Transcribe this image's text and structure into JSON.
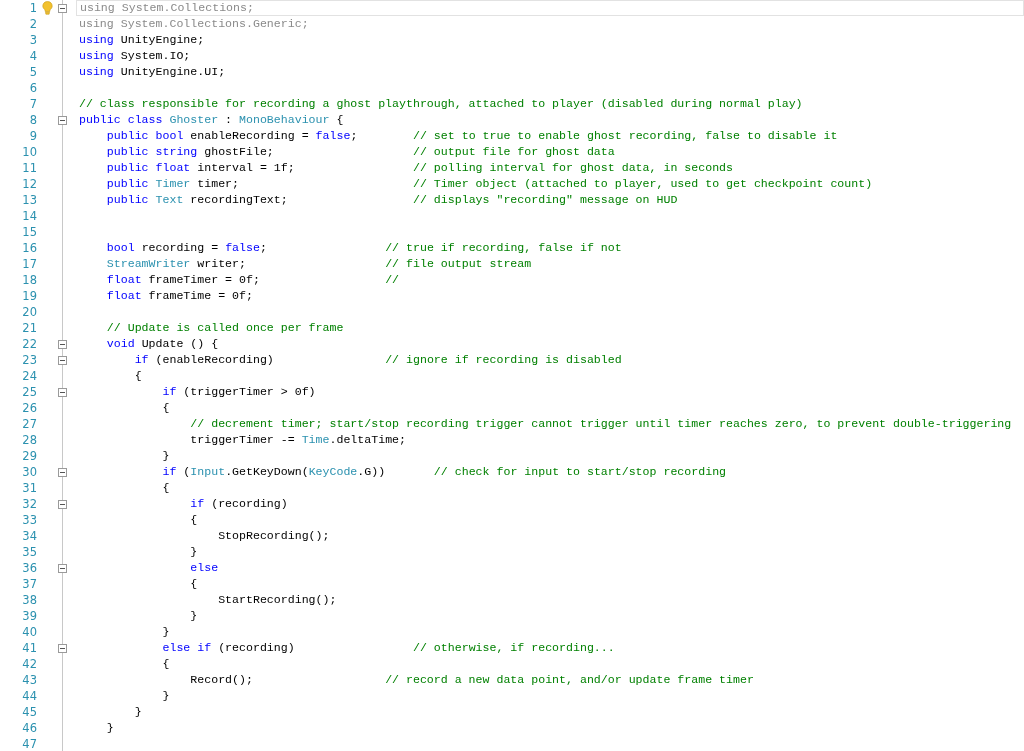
{
  "editor": {
    "lines": [
      {
        "number": "1",
        "current": true,
        "collapsible": true,
        "tokens": [
          {
            "kind": "unused",
            "text": "using System.Collections;"
          }
        ]
      },
      {
        "number": "2",
        "current": false,
        "collapsible": false,
        "tokens": [
          {
            "kind": "unused",
            "text": "using System.Collections.Generic;"
          }
        ]
      },
      {
        "number": "3",
        "current": false,
        "collapsible": false,
        "tokens": [
          {
            "kind": "keyword",
            "text": "using"
          },
          {
            "kind": "plain",
            "text": " UnityEngine;"
          }
        ]
      },
      {
        "number": "4",
        "current": false,
        "collapsible": false,
        "tokens": [
          {
            "kind": "keyword",
            "text": "using"
          },
          {
            "kind": "plain",
            "text": " System.IO;"
          }
        ]
      },
      {
        "number": "5",
        "current": false,
        "collapsible": false,
        "tokens": [
          {
            "kind": "keyword",
            "text": "using"
          },
          {
            "kind": "plain",
            "text": " UnityEngine.UI;"
          }
        ]
      },
      {
        "number": "6",
        "current": false,
        "collapsible": false
      },
      {
        "number": "7",
        "current": false,
        "collapsible": false,
        "tokens": [
          {
            "kind": "comment",
            "text": "// class responsible for recording a ghost playthrough, attached to player (disabled during normal play)"
          }
        ]
      },
      {
        "number": "8",
        "current": false,
        "collapsible": true,
        "tokens": [
          {
            "kind": "keyword",
            "text": "public "
          },
          {
            "kind": "keyword",
            "text": "class "
          },
          {
            "kind": "type",
            "text": "Ghoster"
          },
          {
            "kind": "plain",
            "text": " : "
          },
          {
            "kind": "type",
            "text": "MonoBehaviour"
          },
          {
            "kind": "plain",
            "text": " {"
          }
        ]
      },
      {
        "number": "9",
        "current": false,
        "collapsible": false,
        "tokens": [
          {
            "kind": "keyword",
            "text": "    public "
          },
          {
            "kind": "keyword",
            "text": "bool"
          },
          {
            "kind": "plain",
            "text": " enableRecording = "
          },
          {
            "kind": "keyword",
            "text": "false"
          },
          {
            "kind": "plain",
            "text": ";        "
          },
          {
            "kind": "comment",
            "text": "// set to true to enable ghost recording, false to disable it"
          }
        ]
      },
      {
        "number": "10",
        "current": false,
        "collapsible": false,
        "tokens": [
          {
            "kind": "keyword",
            "text": "    public "
          },
          {
            "kind": "keyword",
            "text": "string"
          },
          {
            "kind": "plain",
            "text": " ghostFile;                    "
          },
          {
            "kind": "comment",
            "text": "// output file for ghost data"
          }
        ]
      },
      {
        "number": "11",
        "current": false,
        "collapsible": false,
        "tokens": [
          {
            "kind": "keyword",
            "text": "    public "
          },
          {
            "kind": "keyword",
            "text": "float"
          },
          {
            "kind": "plain",
            "text": " interval = 1f;                 "
          },
          {
            "kind": "comment",
            "text": "// polling interval for ghost data, in seconds"
          }
        ]
      },
      {
        "number": "12",
        "current": false,
        "collapsible": false,
        "tokens": [
          {
            "kind": "keyword",
            "text": "    public "
          },
          {
            "kind": "type",
            "text": "Timer"
          },
          {
            "kind": "plain",
            "text": " timer;                         "
          },
          {
            "kind": "comment",
            "text": "// Timer object (attached to player, used to get checkpoint count)"
          }
        ]
      },
      {
        "number": "13",
        "current": false,
        "collapsible": false,
        "tokens": [
          {
            "kind": "keyword",
            "text": "    public "
          },
          {
            "kind": "type",
            "text": "Text"
          },
          {
            "kind": "plain",
            "text": " recordingText;                  "
          },
          {
            "kind": "comment",
            "text": "// displays \"recording\" message on HUD"
          }
        ]
      },
      {
        "number": "14",
        "current": false,
        "collapsible": false
      },
      {
        "number": "15",
        "current": false,
        "collapsible": false
      },
      {
        "number": "16",
        "current": false,
        "collapsible": false,
        "tokens": [
          {
            "kind": "keyword",
            "text": "    bool"
          },
          {
            "kind": "plain",
            "text": " recording = "
          },
          {
            "kind": "keyword",
            "text": "false"
          },
          {
            "kind": "plain",
            "text": ";                 "
          },
          {
            "kind": "comment",
            "text": "// true if recording, false if not"
          }
        ]
      },
      {
        "number": "17",
        "current": false,
        "collapsible": false,
        "tokens": [
          {
            "kind": "type",
            "text": "    StreamWriter"
          },
          {
            "kind": "plain",
            "text": " writer;                    "
          },
          {
            "kind": "comment",
            "text": "// file output stream"
          }
        ]
      },
      {
        "number": "18",
        "current": false,
        "collapsible": false,
        "tokens": [
          {
            "kind": "keyword",
            "text": "    float"
          },
          {
            "kind": "plain",
            "text": " frameTimer = 0f;                  "
          },
          {
            "kind": "comment",
            "text": "//"
          }
        ]
      },
      {
        "number": "19",
        "current": false,
        "collapsible": false,
        "tokens": [
          {
            "kind": "keyword",
            "text": "    float"
          },
          {
            "kind": "plain",
            "text": " frameTime = 0f;"
          }
        ]
      },
      {
        "number": "20",
        "current": false,
        "collapsible": false
      },
      {
        "number": "21",
        "current": false,
        "collapsible": false,
        "tokens": [
          {
            "kind": "comment",
            "text": "    // Update is called once per frame"
          }
        ]
      },
      {
        "number": "22",
        "current": false,
        "collapsible": true,
        "tokens": [
          {
            "kind": "keyword",
            "text": "    void"
          },
          {
            "kind": "plain",
            "text": " Update () {"
          }
        ]
      },
      {
        "number": "23",
        "current": false,
        "collapsible": true,
        "tokens": [
          {
            "kind": "keyword",
            "text": "        if"
          },
          {
            "kind": "plain",
            "text": " (enableRecording)                "
          },
          {
            "kind": "comment",
            "text": "// ignore if recording is disabled"
          }
        ]
      },
      {
        "number": "24",
        "current": false,
        "collapsible": false,
        "tokens": [
          {
            "kind": "plain",
            "text": "        {"
          }
        ]
      },
      {
        "number": "25",
        "current": false,
        "collapsible": true,
        "tokens": [
          {
            "kind": "keyword",
            "text": "            if"
          },
          {
            "kind": "plain",
            "text": " (triggerTimer > 0f)"
          }
        ]
      },
      {
        "number": "26",
        "current": false,
        "collapsible": false,
        "tokens": [
          {
            "kind": "plain",
            "text": "            {"
          }
        ]
      },
      {
        "number": "27",
        "current": false,
        "collapsible": false,
        "tokens": [
          {
            "kind": "comment",
            "text": "                // decrement timer; start/stop recording trigger cannot trigger until timer reaches zero, to prevent double-triggering"
          }
        ]
      },
      {
        "number": "28",
        "current": false,
        "collapsible": false,
        "tokens": [
          {
            "kind": "plain",
            "text": "                triggerTimer -= "
          },
          {
            "kind": "type",
            "text": "Time"
          },
          {
            "kind": "plain",
            "text": ".deltaTime;"
          }
        ]
      },
      {
        "number": "29",
        "current": false,
        "collapsible": false,
        "tokens": [
          {
            "kind": "plain",
            "text": "            }"
          }
        ]
      },
      {
        "number": "30",
        "current": false,
        "collapsible": true,
        "tokens": [
          {
            "kind": "keyword",
            "text": "            if"
          },
          {
            "kind": "plain",
            "text": " ("
          },
          {
            "kind": "type",
            "text": "Input"
          },
          {
            "kind": "plain",
            "text": ".GetKeyDown("
          },
          {
            "kind": "type",
            "text": "KeyCode"
          },
          {
            "kind": "plain",
            "text": ".G))       "
          },
          {
            "kind": "comment",
            "text": "// check for input to start/stop recording"
          }
        ]
      },
      {
        "number": "31",
        "current": false,
        "collapsible": false,
        "tokens": [
          {
            "kind": "plain",
            "text": "            {"
          }
        ]
      },
      {
        "number": "32",
        "current": false,
        "collapsible": true,
        "tokens": [
          {
            "kind": "keyword",
            "text": "                if"
          },
          {
            "kind": "plain",
            "text": " (recording)"
          }
        ]
      },
      {
        "number": "33",
        "current": false,
        "collapsible": false,
        "tokens": [
          {
            "kind": "plain",
            "text": "                {"
          }
        ]
      },
      {
        "number": "34",
        "current": false,
        "collapsible": false,
        "tokens": [
          {
            "kind": "plain",
            "text": "                    StopRecording();"
          }
        ]
      },
      {
        "number": "35",
        "current": false,
        "collapsible": false,
        "tokens": [
          {
            "kind": "plain",
            "text": "                }"
          }
        ]
      },
      {
        "number": "36",
        "current": false,
        "collapsible": true,
        "tokens": [
          {
            "kind": "keyword",
            "text": "                else"
          }
        ]
      },
      {
        "number": "37",
        "current": false,
        "collapsible": false,
        "tokens": [
          {
            "kind": "plain",
            "text": "                {"
          }
        ]
      },
      {
        "number": "38",
        "current": false,
        "collapsible": false,
        "tokens": [
          {
            "kind": "plain",
            "text": "                    StartRecording();"
          }
        ]
      },
      {
        "number": "39",
        "current": false,
        "collapsible": false,
        "tokens": [
          {
            "kind": "plain",
            "text": "                }"
          }
        ]
      },
      {
        "number": "40",
        "current": false,
        "collapsible": false,
        "tokens": [
          {
            "kind": "plain",
            "text": "            }"
          }
        ]
      },
      {
        "number": "41",
        "current": false,
        "collapsible": true,
        "tokens": [
          {
            "kind": "keyword",
            "text": "            else "
          },
          {
            "kind": "keyword",
            "text": "if"
          },
          {
            "kind": "plain",
            "text": " (recording)                 "
          },
          {
            "kind": "comment",
            "text": "// otherwise, if recording..."
          }
        ]
      },
      {
        "number": "42",
        "current": false,
        "collapsible": false,
        "tokens": [
          {
            "kind": "plain",
            "text": "            {"
          }
        ]
      },
      {
        "number": "43",
        "current": false,
        "collapsible": false,
        "tokens": [
          {
            "kind": "plain",
            "text": "                Record();                   "
          },
          {
            "kind": "comment",
            "text": "// record a new data point, and/or update frame timer"
          }
        ]
      },
      {
        "number": "44",
        "current": false,
        "collapsible": false,
        "tokens": [
          {
            "kind": "plain",
            "text": "            }"
          }
        ]
      },
      {
        "number": "45",
        "current": false,
        "collapsible": false,
        "tokens": [
          {
            "kind": "plain",
            "text": "        }"
          }
        ]
      },
      {
        "number": "46",
        "current": false,
        "collapsible": false,
        "tokens": [
          {
            "kind": "plain",
            "text": "    }"
          }
        ]
      },
      {
        "number": "47",
        "current": false,
        "collapsible": false
      }
    ]
  }
}
